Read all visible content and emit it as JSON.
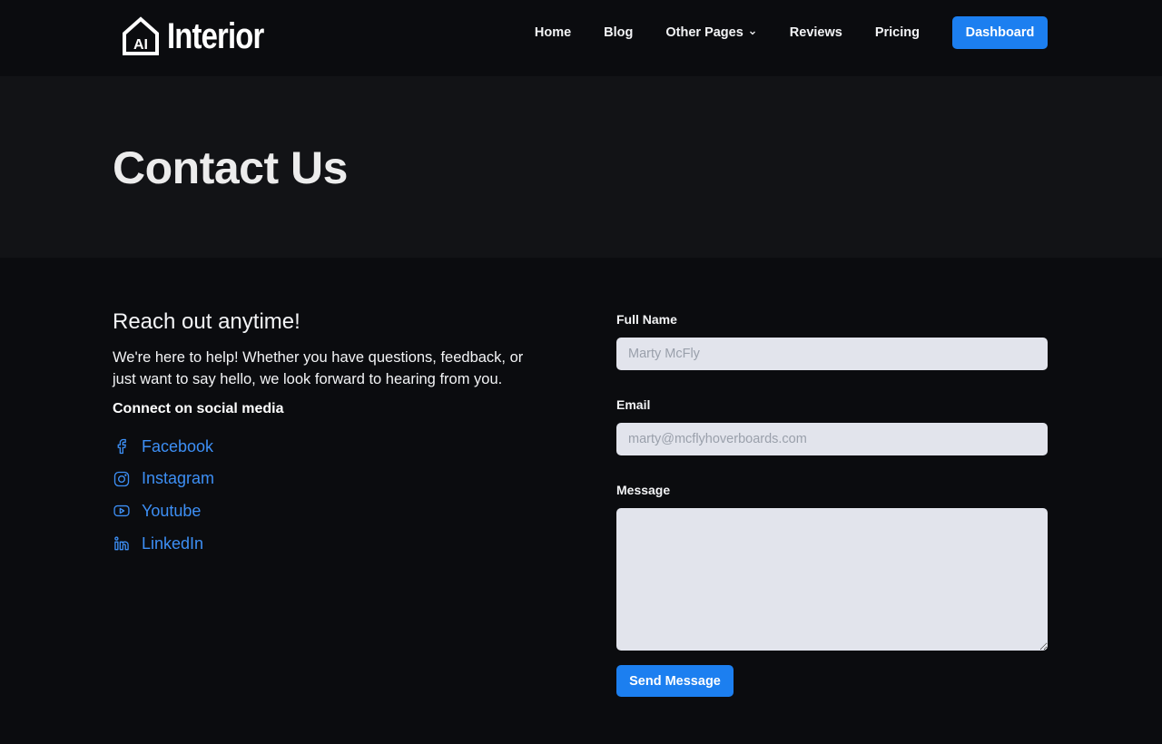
{
  "brand": {
    "badge": "AI",
    "name": "Interior"
  },
  "nav": {
    "items": [
      {
        "label": "Home"
      },
      {
        "label": "Blog"
      },
      {
        "label": "Other Pages"
      },
      {
        "label": "Reviews"
      },
      {
        "label": "Pricing"
      }
    ],
    "dashboard_label": "Dashboard"
  },
  "hero": {
    "title": "Contact Us"
  },
  "contact": {
    "heading": "Reach out anytime!",
    "intro": "We're here to help! Whether you have questions, feedback, or just want to say hello, we look forward to hearing from you.",
    "social_heading": "Connect on social media",
    "social": [
      {
        "label": "Facebook",
        "icon": "facebook-icon"
      },
      {
        "label": "Instagram",
        "icon": "instagram-icon"
      },
      {
        "label": "Youtube",
        "icon": "youtube-icon"
      },
      {
        "label": "LinkedIn",
        "icon": "linkedin-icon"
      }
    ]
  },
  "form": {
    "name_label": "Full Name",
    "name_placeholder": "Marty McFly",
    "name_value": "",
    "email_label": "Email",
    "email_placeholder": "marty@mcflyhoverboards.com",
    "email_value": "",
    "message_label": "Message",
    "message_value": "",
    "submit_label": "Send Message"
  },
  "colors": {
    "accent": "#1c7ff0",
    "link": "#3d8ff5",
    "background": "#0b0c0f",
    "hero_background": "#121316",
    "input_background": "#e2e4ec"
  }
}
